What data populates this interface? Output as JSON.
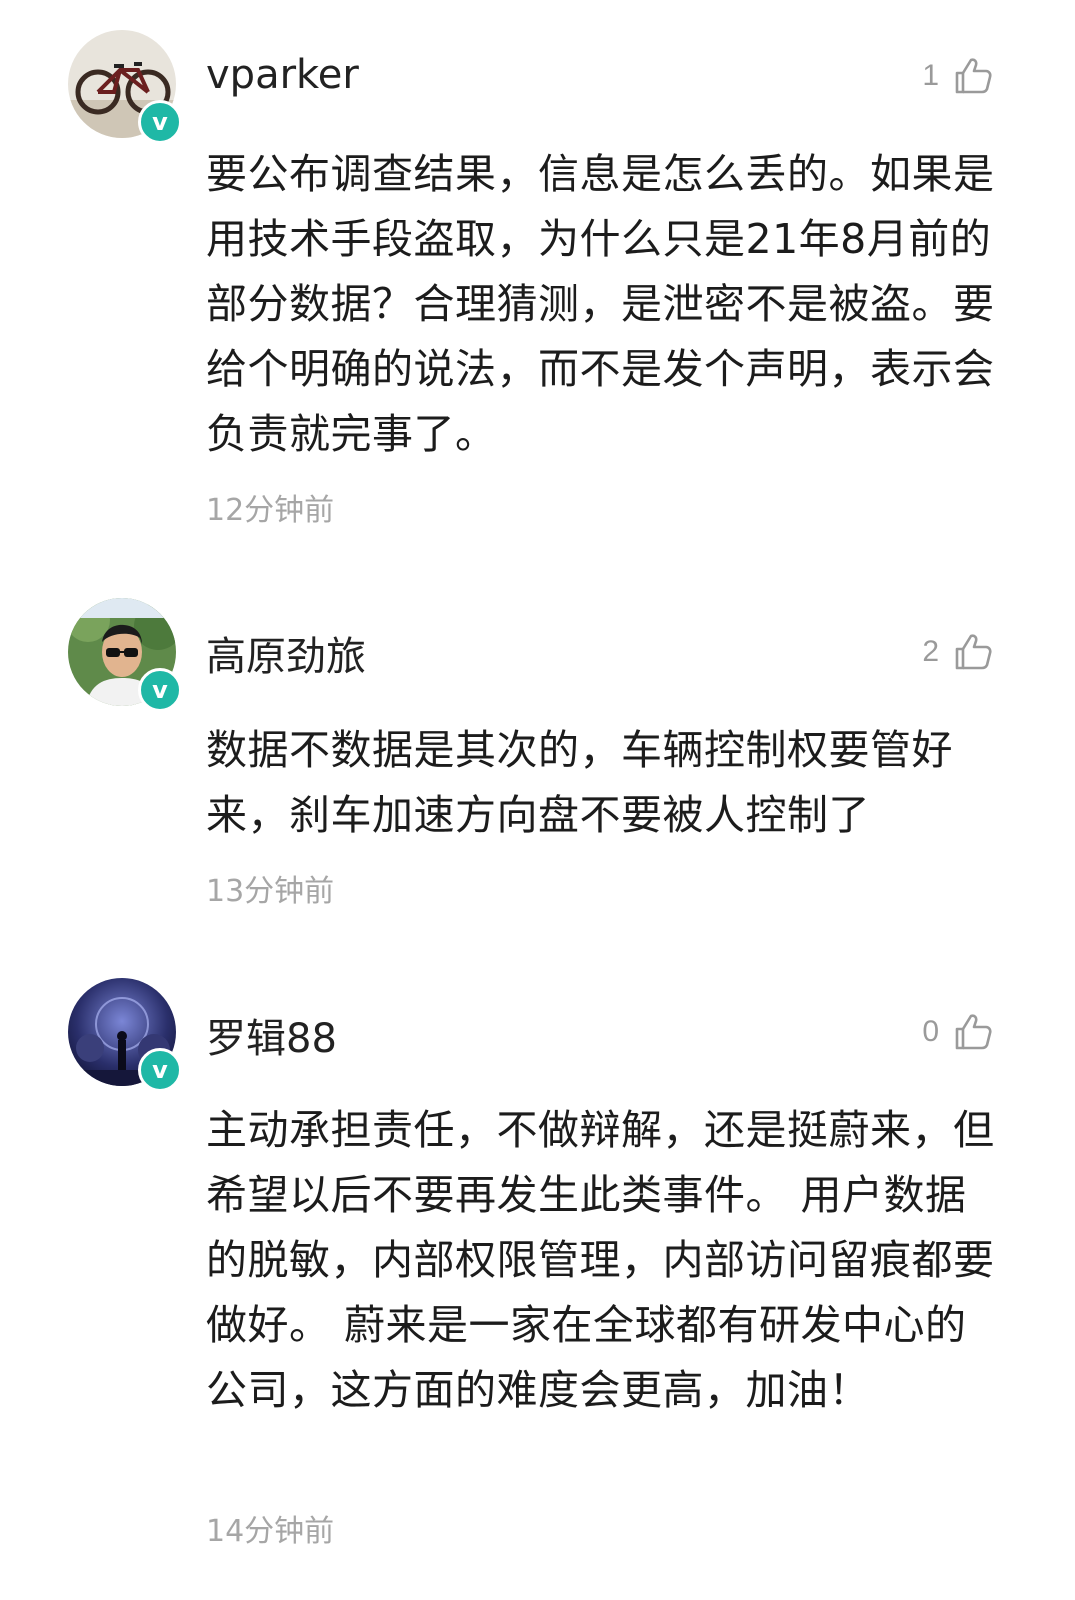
{
  "comments": [
    {
      "username": "vparker",
      "likes": "1",
      "text": "要公布调查结果，信息是怎么丢的。如果是用技术手段盗取，为什么只是21年8月前的部分数据？合理猜测，是泄密不是被盗。要给个明确的说法，而不是发个声明，表示会负责就完事了。",
      "time": "12分钟前",
      "verified_badge": "v",
      "avatar_icon": "bicycle-avatar"
    },
    {
      "username": "高原劲旅",
      "likes": "2",
      "text": "数据不数据是其次的，车辆控制权要管好来，刹车加速方向盘不要被人控制了",
      "time": "13分钟前",
      "verified_badge": "v",
      "avatar_icon": "person-sunglasses-avatar"
    },
    {
      "username": "罗辑88",
      "likes": "0",
      "text": "主动承担责任，不做辩解，还是挺蔚来，但希望以后不要再发生此类事件。 用户数据的脱敏，内部权限管理，内部访问留痕都要做好。 蔚来是一家在全球都有研发中心的公司，这方面的难度会更高，加油！",
      "time": "14分钟前",
      "verified_badge": "v",
      "avatar_icon": "space-scene-avatar"
    }
  ],
  "colors": {
    "verified": "#1fb8a6",
    "muted": "#a6a6a6"
  }
}
